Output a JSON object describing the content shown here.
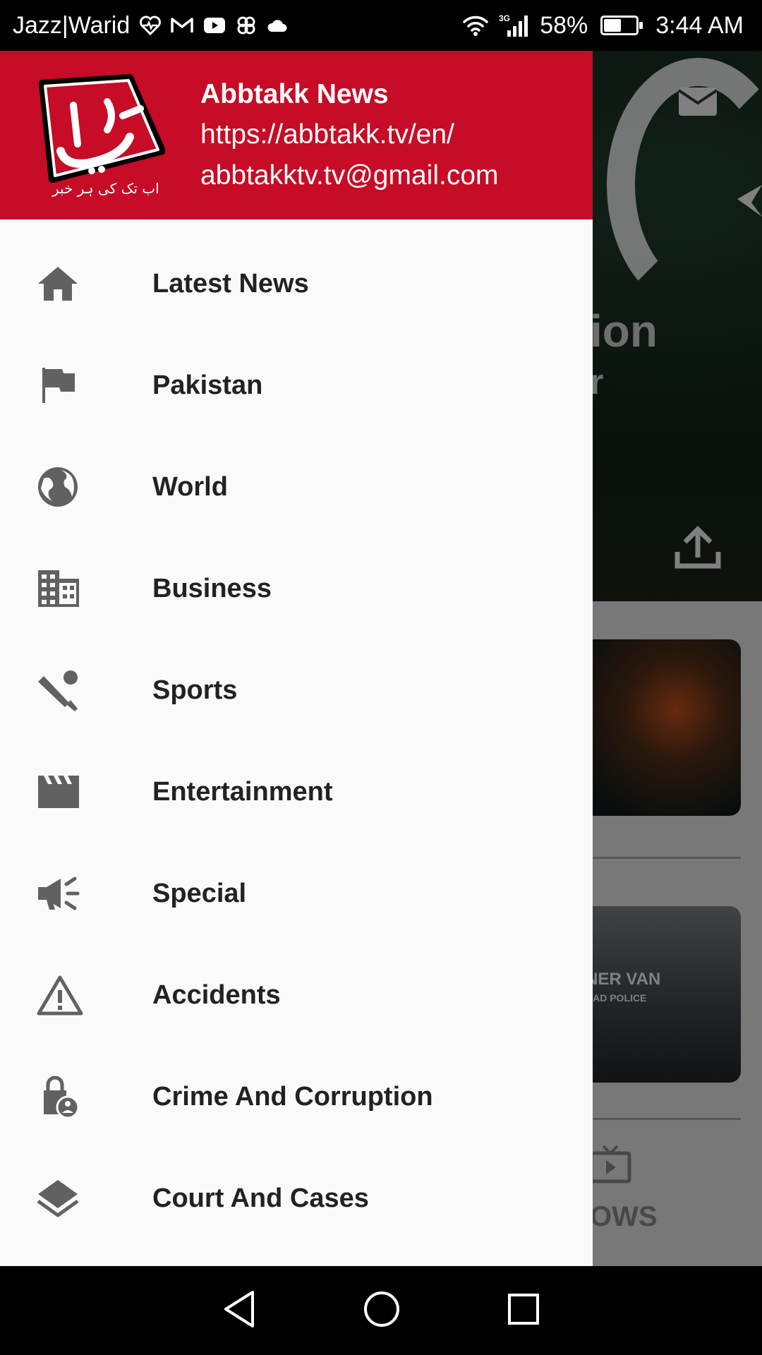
{
  "status_bar": {
    "carrier": "Jazz|Warid",
    "network_type": "3G",
    "battery_percent": "58%",
    "battery_level": 0.58,
    "time": "3:44 AM",
    "icons": [
      "heart-monitor-icon",
      "gmail-icon",
      "youtube-icon",
      "pinwheel-icon",
      "cloud-icon",
      "wifi-icon",
      "signal-icon",
      "battery-icon"
    ]
  },
  "drawer": {
    "header": {
      "background_color": "#c60c26",
      "title": "Abbtakk News",
      "website": "https://abbtakk.tv/en/",
      "email": "abbtakktv.tv@gmail.com",
      "logo_text": "اب تک",
      "logo_tagline": "اب تک کی ہر خبر"
    },
    "items": [
      {
        "label": "Latest News",
        "icon": "home-icon"
      },
      {
        "label": "Pakistan",
        "icon": "flag-icon"
      },
      {
        "label": "World",
        "icon": "globe-icon"
      },
      {
        "label": "Business",
        "icon": "business-building-icon"
      },
      {
        "label": "Sports",
        "icon": "cricket-icon"
      },
      {
        "label": "Entertainment",
        "icon": "clapperboard-icon"
      },
      {
        "label": "Special",
        "icon": "megaphone-icon"
      },
      {
        "label": "Accidents",
        "icon": "warning-icon"
      },
      {
        "label": "Crime And Corruption",
        "icon": "lock-person-icon"
      },
      {
        "label": "Court And Cases",
        "icon": "layers-icon"
      }
    ]
  },
  "background": {
    "hero_text": "ion",
    "hero_subtext": "r",
    "card2_text": "NER VAN",
    "card2_subtext": "BAD POLICE",
    "shows_label": "OWS"
  },
  "nav_bar": {
    "buttons": [
      "back-icon",
      "home-circle-icon",
      "recents-icon"
    ]
  }
}
